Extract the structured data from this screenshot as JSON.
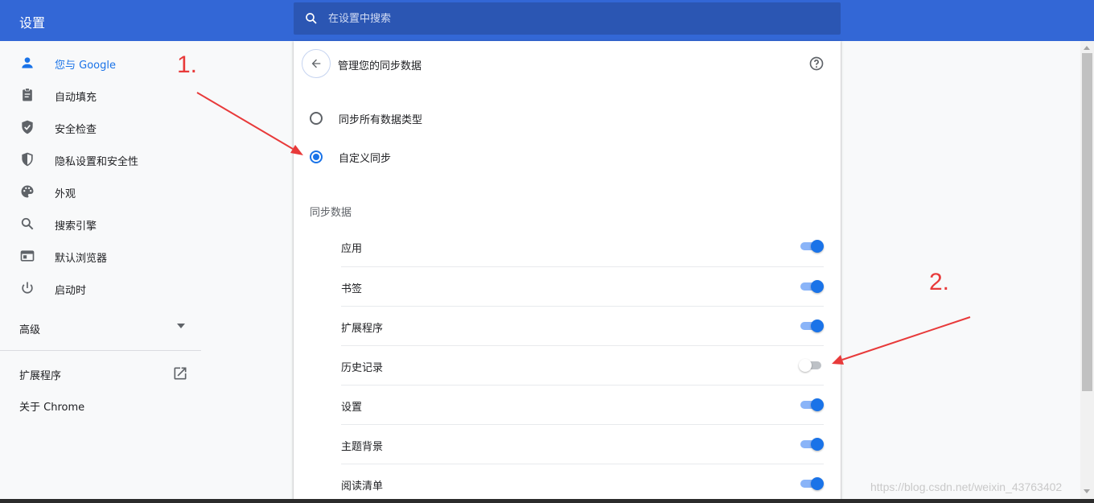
{
  "header": {
    "title": "设置",
    "search_placeholder": "在设置中搜索"
  },
  "sidebar": {
    "items": [
      {
        "label": "您与 Google",
        "icon": "person-icon",
        "active": true
      },
      {
        "label": "自动填充",
        "icon": "clipboard-icon"
      },
      {
        "label": "安全检查",
        "icon": "shield-check-icon"
      },
      {
        "label": "隐私设置和安全性",
        "icon": "shield-half-icon"
      },
      {
        "label": "外观",
        "icon": "palette-icon"
      },
      {
        "label": "搜索引擎",
        "icon": "search-icon"
      },
      {
        "label": "默认浏览器",
        "icon": "browser-icon"
      },
      {
        "label": "启动时",
        "icon": "power-icon"
      }
    ],
    "advanced": "高级",
    "extensions": "扩展程序",
    "about": "关于 Chrome"
  },
  "main": {
    "title": "管理您的同步数据",
    "radio_options": [
      {
        "label": "同步所有数据类型",
        "selected": false
      },
      {
        "label": "自定义同步",
        "selected": true
      }
    ],
    "section_heading": "同步数据",
    "sync_items": [
      {
        "label": "应用",
        "enabled": true
      },
      {
        "label": "书签",
        "enabled": true
      },
      {
        "label": "扩展程序",
        "enabled": true
      },
      {
        "label": "历史记录",
        "enabled": false
      },
      {
        "label": "设置",
        "enabled": true
      },
      {
        "label": "主题背景",
        "enabled": true
      },
      {
        "label": "阅读清单",
        "enabled": true
      }
    ]
  },
  "annotations": {
    "note1": "1.",
    "note2": "2.",
    "color": "#e83a3a"
  },
  "watermark": "https://blog.csdn.net/weixin_43763402",
  "colors": {
    "header_bg": "#3367d6",
    "accent": "#1a73e8"
  }
}
